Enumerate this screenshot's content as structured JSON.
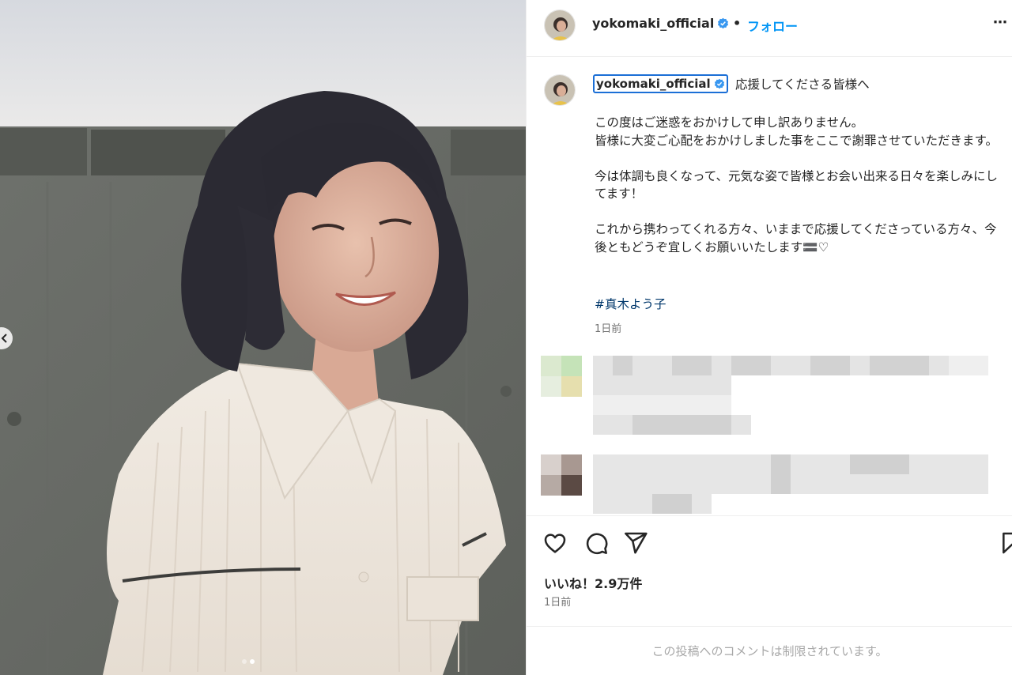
{
  "post": {
    "username": "yokomaki_official",
    "separator": "•",
    "follow_label": "フォロー",
    "more_label": "⋯"
  },
  "caption": {
    "username": "yokomaki_official",
    "first_line": "応援してくださる皆様へ",
    "paragraphs": [
      "この度はご迷惑をおかけして申し訳ありません。\n皆様に大変ご心配をおかけしました事をここで謝罪させていただきます。",
      "今は体調も良くなって、元気な姿で皆様とお会い出来る日々を楽しみにしてます！",
      "これから携わってくれる方々、いままで応援してくださっている方々、今後ともどうぞ宜しくお願いいたします🟰♡"
    ],
    "hashtag": "#真木よう子",
    "time": "1日前"
  },
  "engagement": {
    "likes_text": "いいね！2.9万件",
    "time": "1日前"
  },
  "footer": {
    "comments_restricted": "この投稿へのコメントは制限されています。"
  },
  "icons": {
    "like": "heart-icon",
    "comment": "comment-icon",
    "share": "send-icon",
    "save": "bookmark-icon",
    "verified": "verified-badge-icon",
    "carousel_prev": "chevron-left-icon"
  },
  "carousel": {
    "total": 2,
    "current": 2
  },
  "colors": {
    "accent": "#0095f6",
    "verified": "#3897f0",
    "hashtag": "#00376b",
    "muted": "#737373"
  }
}
